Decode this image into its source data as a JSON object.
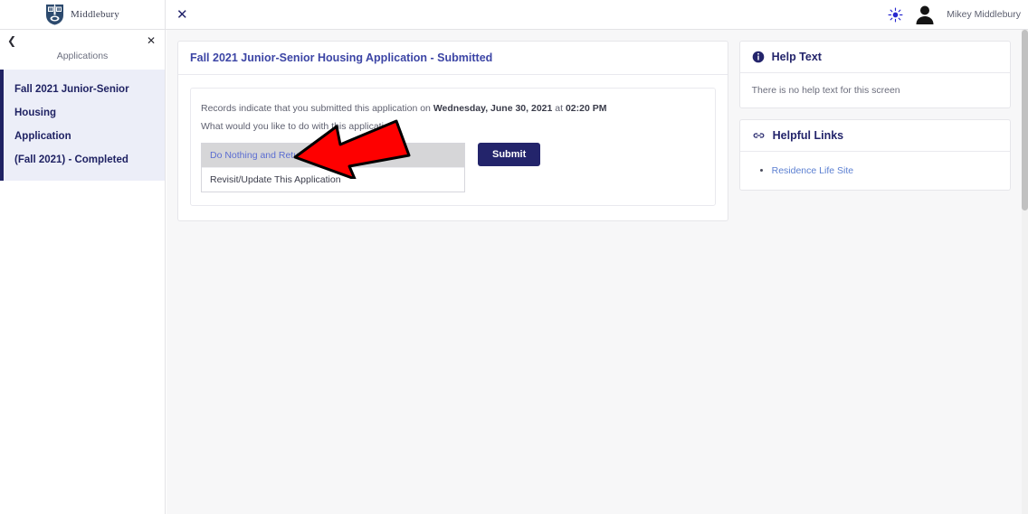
{
  "topbar": {
    "brand_name": "Middlebury",
    "crest_icon": "middlebury-shield-crest",
    "close_icon": "close-icon",
    "theme_icon": "brightness-sun-icon",
    "avatar_icon": "user-avatar-icon",
    "user_name": "Mikey Middlebury"
  },
  "sidebar": {
    "back_icon": "chevron-left-icon",
    "close_icon": "close-icon",
    "title": "Applications",
    "items": [
      {
        "title": "Fall 2021 Junior-Senior Housing",
        "title2": "Application",
        "sub": "(Fall 2021) - Completed"
      }
    ]
  },
  "main": {
    "card_title": "Fall 2021 Junior-Senior Housing Application - Submitted",
    "record_prefix": "Records indicate that you submitted this application on ",
    "record_date": "Wednesday, June 30, 2021",
    "record_mid": " at ",
    "record_time": "02:20 PM",
    "question": "What would you like to do with this application?",
    "options": [
      {
        "label": "Do Nothing and Return to Main Menu",
        "selected": true
      },
      {
        "label": "Revisit/Update This Application",
        "selected": false
      }
    ],
    "submit_label": "Submit"
  },
  "help_card": {
    "icon": "info-circle-icon",
    "title": "Help Text",
    "body": "There is no help text for this screen"
  },
  "links_card": {
    "icon": "chain-link-icon",
    "title": "Helpful Links",
    "links": [
      {
        "label": "Residence Life Site"
      }
    ]
  },
  "annotation": {
    "arrow_icon": "red-arrow-pointing-left"
  },
  "colors": {
    "brand_navy": "#23246b",
    "title_blue": "#3c45a5",
    "link_blue": "#5b7fd1",
    "selected_option_bg": "#d6d6d8",
    "sidebar_selected_bg": "#eceef8",
    "main_bg": "#f7f7f8",
    "arrow_red": "#fe0000"
  }
}
